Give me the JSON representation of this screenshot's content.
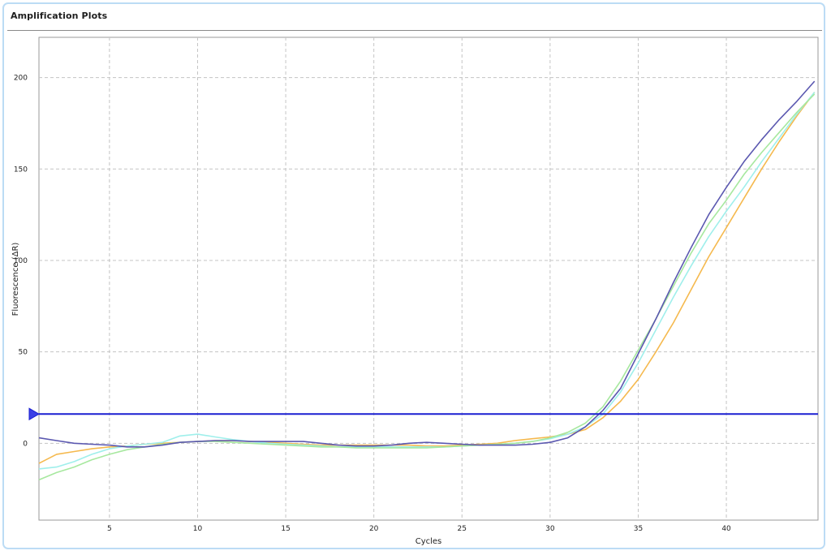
{
  "panel": {
    "title": "Amplification Plots"
  },
  "chart_data": {
    "type": "line",
    "title": "",
    "xlabel": "Cycles",
    "ylabel": "Fluorescence (ΔR)",
    "xlim": [
      1,
      45.2
    ],
    "ylim": [
      -42,
      222
    ],
    "xticks": [
      5,
      10,
      15,
      20,
      25,
      30,
      35,
      40
    ],
    "yticks": [
      0,
      50,
      100,
      150,
      200
    ],
    "grid": true,
    "legend": "none",
    "threshold": {
      "value": 16,
      "color": "#1a1fd1"
    },
    "x": [
      1,
      2,
      3,
      4,
      5,
      6,
      7,
      8,
      9,
      10,
      11,
      12,
      13,
      14,
      15,
      16,
      17,
      18,
      19,
      20,
      21,
      22,
      23,
      24,
      25,
      26,
      27,
      28,
      29,
      30,
      31,
      32,
      33,
      34,
      35,
      36,
      37,
      38,
      39,
      40,
      41,
      42,
      43,
      44,
      45
    ],
    "series": [
      {
        "color": "#f5b94e",
        "values": [
          -11,
          -6,
          -4.5,
          -3,
          -2,
          -1.5,
          -0.5,
          0,
          0.5,
          1,
          1.5,
          1.5,
          1,
          0.5,
          0,
          -0.5,
          -1,
          -1,
          -1,
          -1,
          -1,
          -1,
          -1.5,
          -1.5,
          -1,
          -0.5,
          0,
          1.5,
          2.5,
          3.5,
          5,
          7.5,
          14,
          23,
          35,
          50,
          66,
          84,
          102,
          118,
          134,
          150,
          165,
          179,
          192
        ]
      },
      {
        "color": "#9fefeb",
        "values": [
          -14,
          -13,
          -10,
          -6,
          -3,
          -1.5,
          -0.5,
          0.5,
          4,
          5,
          3.5,
          2,
          1,
          0,
          -0.5,
          -1,
          -1.5,
          -2,
          -2,
          -2,
          -2,
          -2,
          -2,
          -2,
          -1.5,
          -1,
          -0.5,
          0,
          1,
          2.5,
          5,
          9,
          16,
          28,
          44,
          62,
          80,
          97,
          113,
          127,
          140,
          154,
          167,
          180,
          192
        ]
      },
      {
        "color": "#a7e89f",
        "values": [
          -20,
          -16,
          -13,
          -9,
          -6,
          -3.5,
          -2,
          -0.5,
          0.5,
          1,
          1,
          0.5,
          0,
          -0.5,
          -1,
          -1.5,
          -2,
          -2,
          -2.5,
          -2.5,
          -2.5,
          -2.5,
          -2.5,
          -2,
          -1.5,
          -1,
          -0.5,
          0,
          1,
          3,
          6,
          11,
          20,
          34,
          51,
          68,
          86,
          104,
          120,
          133,
          147,
          159,
          170,
          181,
          191
        ]
      },
      {
        "color": "#5b58b0",
        "values": [
          3,
          1.5,
          0,
          -0.5,
          -1,
          -2,
          -2,
          -1,
          0.5,
          1,
          1.5,
          1.5,
          1,
          1,
          1,
          1,
          0,
          -1,
          -1.5,
          -1.5,
          -1,
          0,
          0.5,
          0,
          -0.5,
          -1,
          -1,
          -1,
          -0.5,
          0.5,
          3,
          9,
          18,
          30,
          49,
          68,
          88,
          107,
          125,
          140,
          154,
          166,
          177,
          187,
          198
        ]
      }
    ]
  }
}
